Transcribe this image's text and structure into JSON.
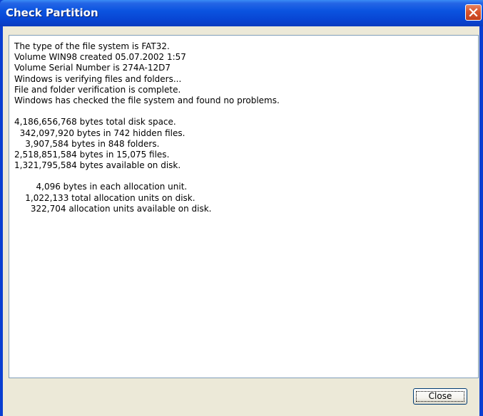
{
  "window": {
    "title": "Check Partition"
  },
  "log": {
    "lines": [
      "The type of the file system is FAT32.",
      "Volume WIN98 created 05.07.2002 1:57",
      "Volume Serial Number is 274A-12D7",
      "Windows is verifying files and folders...",
      "File and folder verification is complete.",
      "Windows has checked the file system and found no problems.",
      "",
      "4,186,656,768 bytes total disk space.",
      "  342,097,920 bytes in 742 hidden files.",
      "    3,907,584 bytes in 848 folders.",
      "2,518,851,584 bytes in 15,075 files.",
      "1,321,795,584 bytes available on disk.",
      "",
      "        4,096 bytes in each allocation unit.",
      "    1,022,133 total allocation units on disk.",
      "      322,704 allocation units available on disk."
    ]
  },
  "buttons": {
    "close_label": "Close"
  },
  "icons": {
    "close": "close-x-icon"
  },
  "colors": {
    "titlebar": "#0b54e0",
    "close_button": "#d9542c",
    "dialog_face": "#ece9d8"
  }
}
